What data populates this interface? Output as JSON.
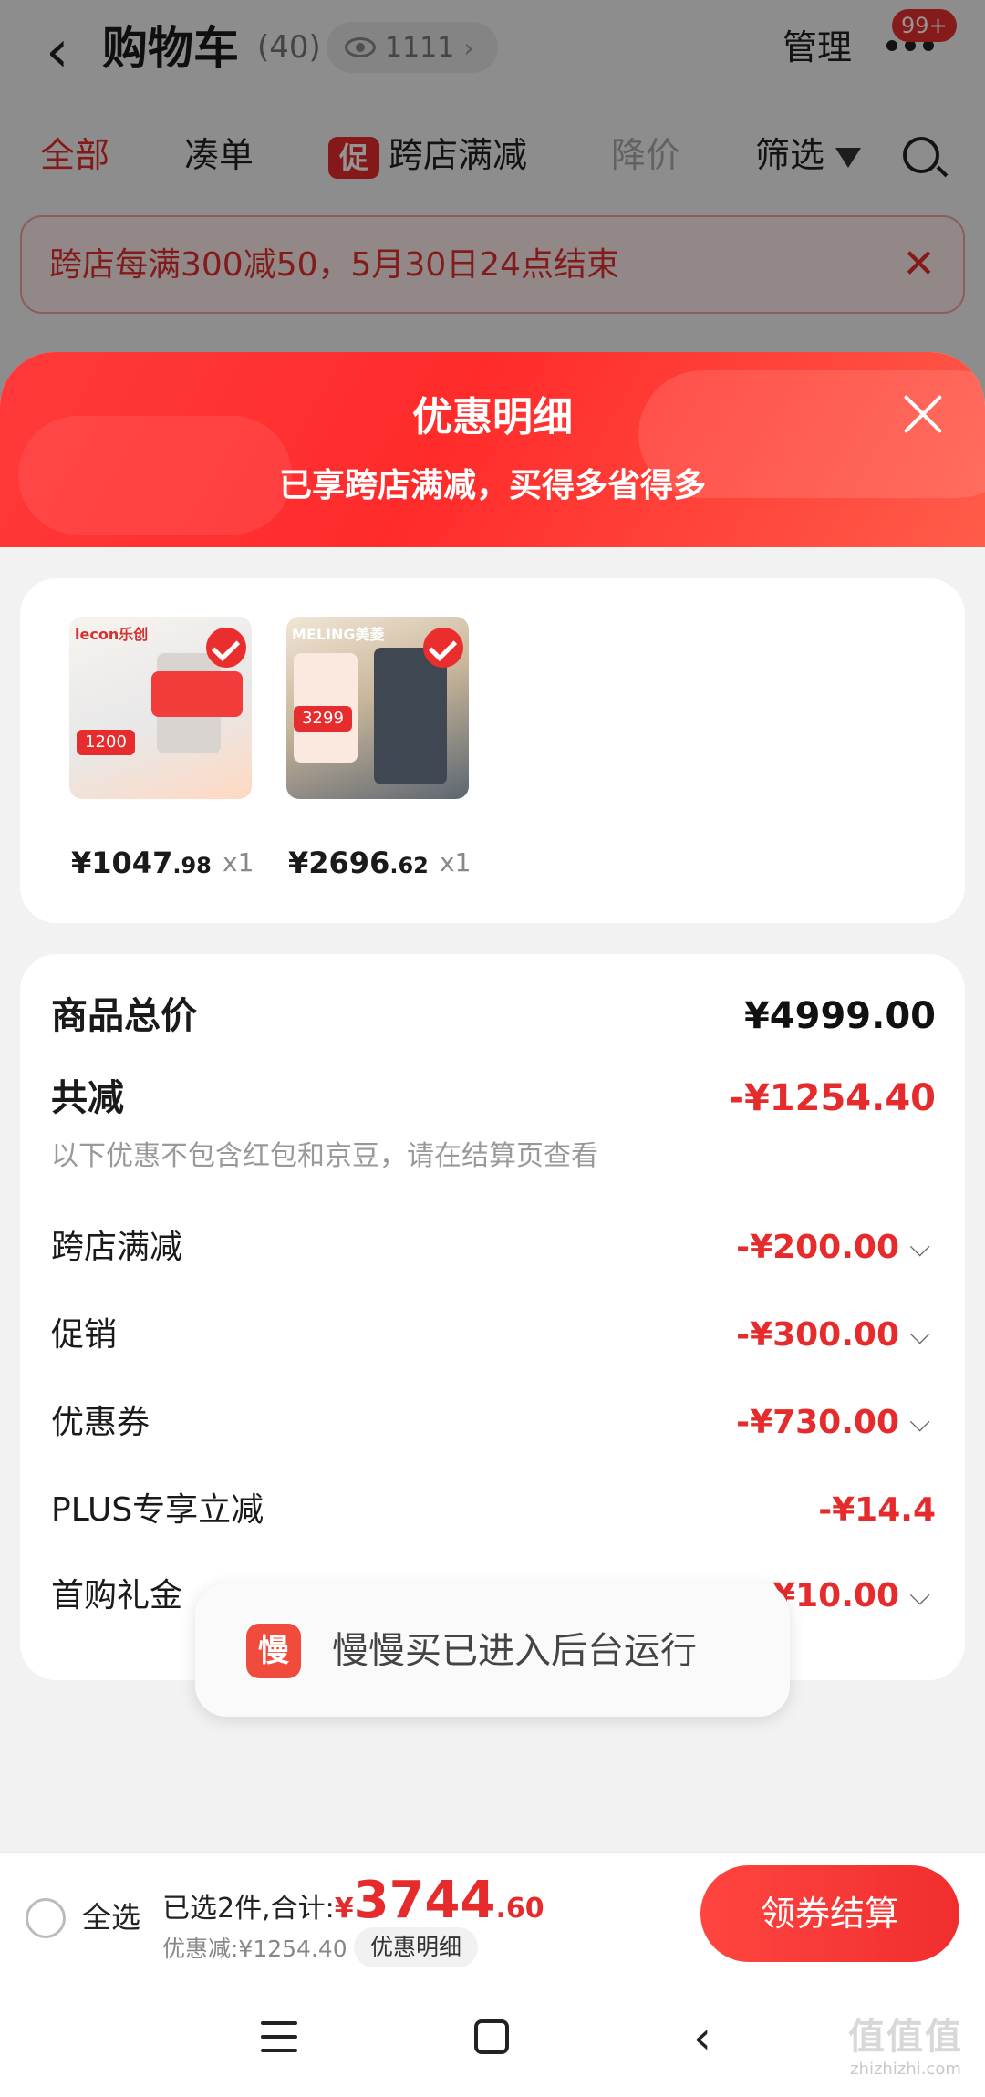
{
  "cart": {
    "title": "购物车",
    "count": "(40)",
    "follow_count": "1111",
    "manage": "管理",
    "badge": "99+",
    "tabs": [
      "全部",
      "凑单",
      "跨店满减",
      "降价",
      "筛选"
    ],
    "promo_chip": "促",
    "notice": "跨店每满300减50，5月30日24点结束"
  },
  "sheet": {
    "title": "优惠明细",
    "subtitle": "已享跨店满减，买得多省得多",
    "products": [
      {
        "brand": "lecon乐创",
        "price_int": "¥1047",
        "price_dec": ".98",
        "qty": "x1",
        "thumb_tag": "1200"
      },
      {
        "brand": "MELING美菱",
        "price_int": "¥2696",
        "price_dec": ".62",
        "qty": "x1",
        "thumb_tag": "3299"
      }
    ],
    "total_label": "商品总价",
    "total_value": "¥4999.00",
    "reduce_label": "共减",
    "reduce_value": "-¥1254.40",
    "reduce_note": "以下优惠不包含红包和京豆，请在结算页查看",
    "items": [
      {
        "label": "跨店满减",
        "value": "-¥200.00"
      },
      {
        "label": "促销",
        "value": "-¥300.00"
      },
      {
        "label": "优惠券",
        "value": "-¥730.00"
      },
      {
        "label": "PLUS专享立减",
        "value": "-¥14.4"
      },
      {
        "label": "首购礼金",
        "value": "-¥10.00"
      }
    ]
  },
  "toast": {
    "icon_char": "慢",
    "text": "慢慢买已进入后台运行"
  },
  "bottom": {
    "select_all": "全选",
    "summary_prefix": "已选2件,合计:",
    "yen": "¥",
    "total_int": "3744",
    "total_dec": ".60",
    "discount": "优惠减:¥1254.40",
    "detail_link": "优惠明细",
    "checkout": "领券结算"
  },
  "watermark": {
    "main": "值值值",
    "sub": "zhizhizhi.com"
  },
  "colors": {
    "accent": "#e52b2b",
    "header_gradient_start": "#ff3a3a",
    "header_gradient_end": "#ff5c4a"
  },
  "icons": [
    "back-arrow-icon",
    "eye-icon",
    "more-icon",
    "filter-icon",
    "search-icon",
    "close-icon",
    "check-icon",
    "chevron-down-icon",
    "menu-icon",
    "home-icon"
  ]
}
